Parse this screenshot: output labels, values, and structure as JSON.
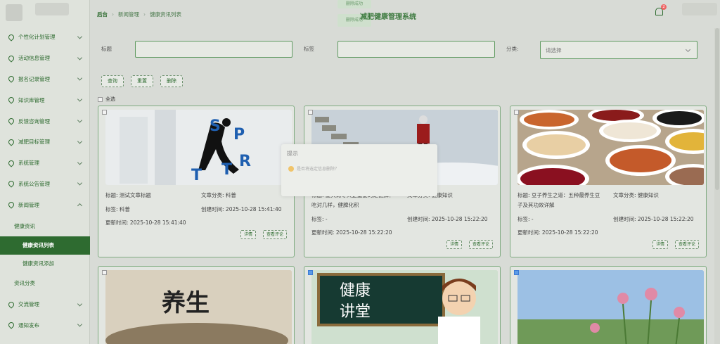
{
  "sidebar": {
    "items": [
      {
        "label": "个性化计划管理"
      },
      {
        "label": "活动信息管理"
      },
      {
        "label": "报名记录管理"
      },
      {
        "label": "知识库管理"
      },
      {
        "label": "反馈咨询管理"
      },
      {
        "label": "减肥目标管理"
      },
      {
        "label": "系统管理"
      },
      {
        "label": "系统公告管理"
      },
      {
        "label": "新闻管理"
      }
    ],
    "sub": {
      "label": "健康资讯"
    },
    "subsub": [
      {
        "label": "健康资讯列表"
      },
      {
        "label": "健康资讯添加"
      }
    ],
    "tail": [
      {
        "label": "资讯分类"
      },
      {
        "label": "交流管理"
      },
      {
        "label": "通知发布"
      }
    ]
  },
  "header": {
    "breadcrumb": [
      "后台",
      "新闻管理",
      "健康资讯列表"
    ],
    "title": "减肥健康管理系统",
    "toast1": "删除成功",
    "toast2": "删除成功",
    "badge": "2"
  },
  "search": {
    "title_label": "标题",
    "tag_label": "标签",
    "category_label": "分类:",
    "category_placeholder": "请选择",
    "query": "查询",
    "reset": "重置",
    "delete": "删除",
    "select_all": "全选"
  },
  "dialog": {
    "title": "提示",
    "body": "是否将选定信息删除？"
  },
  "cards": [
    {
      "title_k": "标题:",
      "title": "测试文章标题",
      "cat_k": "文章分类:",
      "cat": "科普",
      "tag_k": "标签:",
      "tag": "科普",
      "ct_k": "创建时间:",
      "ct": "2025-10-28 15:41:40",
      "ut_k": "更新时间:",
      "ut": "2025-10-28 15:41:40",
      "detail": "详情",
      "comments": "查看评论"
    },
    {
      "title_k": "标题:",
      "title": "夏天比冬天更重要的是健脾！吃对几样，健脾化积",
      "cat_k": "文章分类:",
      "cat": "健康知识",
      "tag_k": "标签:",
      "tag": "-",
      "ct_k": "创建时间:",
      "ct": "2025-10-28 15:22:20",
      "ut_k": "更新时间:",
      "ut": "2025-10-28 15:22:20",
      "detail": "详情",
      "comments": "查看评论"
    },
    {
      "title_k": "标题:",
      "title": "豆子养生之道：五种最养生豆子及其功效详解",
      "cat_k": "文章分类:",
      "cat": "健康知识",
      "tag_k": "标签:",
      "tag": "-",
      "ct_k": "创建时间:",
      "ct": "2025-10-28 15:22:20",
      "ut_k": "更新时间:",
      "ut": "2025-10-28 15:22:20",
      "detail": "详情",
      "comments": "查看评论"
    }
  ],
  "card2": {
    "title_line1": "夏天比冬天更重要的是健脾！",
    "title_line2": "吃对几样，健脾化积"
  },
  "card3": {
    "title_line1": "豆子养生之道：五种最养生豆",
    "title_line2": "子及其功效详解"
  },
  "images": {
    "sport_text": "SPORT",
    "yang_text": "养生",
    "lecture_text1": "健康",
    "lecture_text2": "讲堂"
  }
}
